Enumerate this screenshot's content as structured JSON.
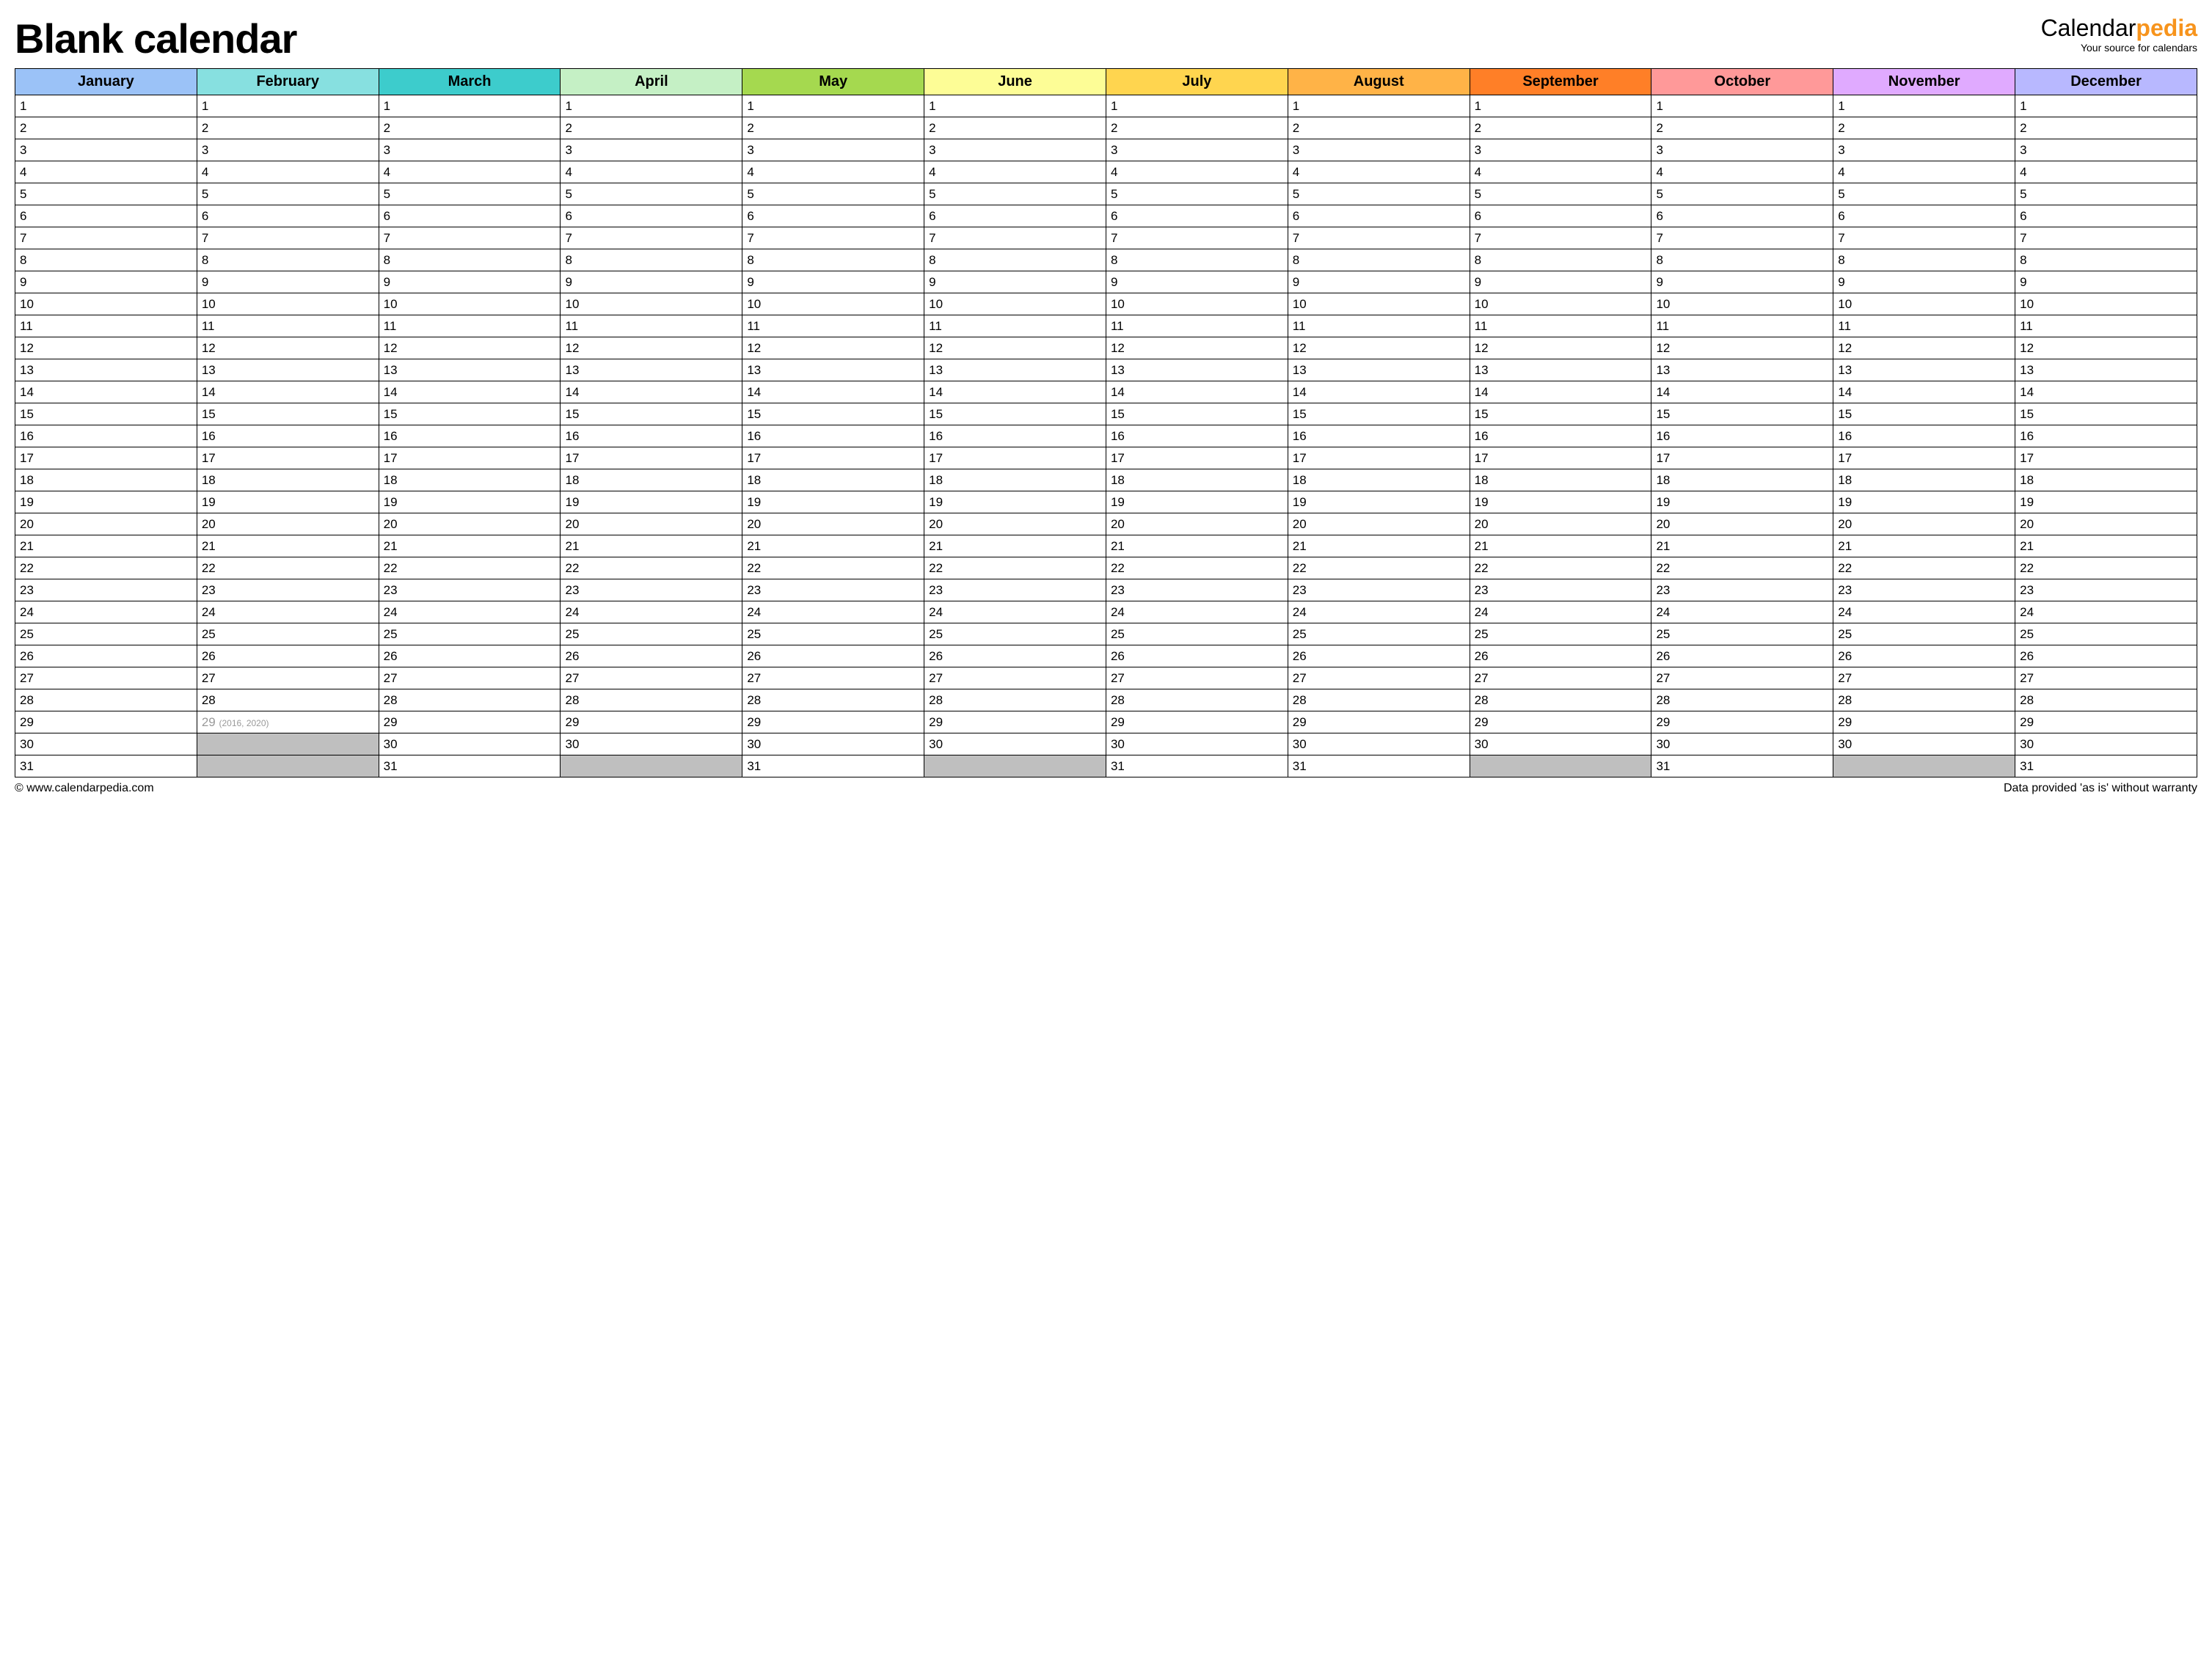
{
  "title": "Blank calendar",
  "brand": {
    "prefix": "Calendar",
    "suffix": "pedia",
    "tagline": "Your source for calendars"
  },
  "months": [
    {
      "name": "January",
      "days": 31,
      "color_class": "m1"
    },
    {
      "name": "February",
      "days": 29,
      "color_class": "m2",
      "leap_note": "(2016, 2020)"
    },
    {
      "name": "March",
      "days": 31,
      "color_class": "m3"
    },
    {
      "name": "April",
      "days": 30,
      "color_class": "m4"
    },
    {
      "name": "May",
      "days": 31,
      "color_class": "m5"
    },
    {
      "name": "June",
      "days": 30,
      "color_class": "m6"
    },
    {
      "name": "July",
      "days": 31,
      "color_class": "m7"
    },
    {
      "name": "August",
      "days": 31,
      "color_class": "m8"
    },
    {
      "name": "September",
      "days": 30,
      "color_class": "m9"
    },
    {
      "name": "October",
      "days": 31,
      "color_class": "m10"
    },
    {
      "name": "November",
      "days": 30,
      "color_class": "m11"
    },
    {
      "name": "December",
      "days": 31,
      "color_class": "m12"
    }
  ],
  "max_days": 31,
  "footer": {
    "left": "© www.calendarpedia.com",
    "right": "Data provided 'as is' without warranty"
  }
}
